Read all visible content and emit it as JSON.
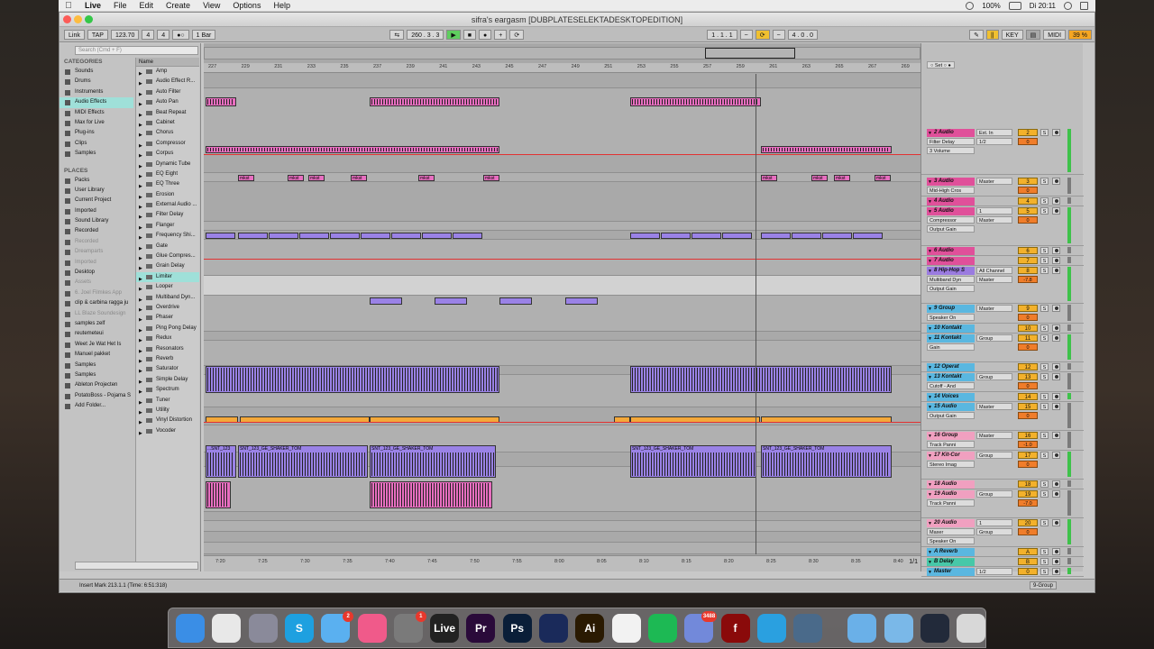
{
  "menubar": {
    "items": [
      "Live",
      "File",
      "Edit",
      "Create",
      "View",
      "Options",
      "Help"
    ],
    "battery": "100%",
    "clock": "Di 20:11",
    "icons": [
      "apple-icon",
      "wifi-icon",
      "battery-icon",
      "search-icon",
      "notification-icon"
    ]
  },
  "window": {
    "title": "sifra's eargasm  [DUBPLATESELEKTADESKTOPEDITION]"
  },
  "controlbar": {
    "link": "Link",
    "tap": "TAP",
    "tempo": "123.70",
    "signature_num": "4",
    "signature_den": "4",
    "quantize": "1 Bar",
    "position": "260 .   3 .   3",
    "loop_start": "1 .   1 .   1",
    "loop_length": "4 .   0 .   0",
    "key": "KEY",
    "midi": "MIDI",
    "cpu": "39 %"
  },
  "browser": {
    "search_placeholder": "Search (Cmd + F)",
    "categories_header": "CATEGORIES",
    "categories": [
      {
        "label": "Sounds",
        "selected": false
      },
      {
        "label": "Drums",
        "selected": false
      },
      {
        "label": "Instruments",
        "selected": false
      },
      {
        "label": "Audio Effects",
        "selected": true
      },
      {
        "label": "MIDI Effects",
        "selected": false
      },
      {
        "label": "Max for Live",
        "selected": false
      },
      {
        "label": "Plug-ins",
        "selected": false
      },
      {
        "label": "Clips",
        "selected": false
      },
      {
        "label": "Samples",
        "selected": false
      }
    ],
    "places_header": "PLACES",
    "places": [
      {
        "label": "Packs",
        "dim": false
      },
      {
        "label": "User Library",
        "dim": false
      },
      {
        "label": "Current Project",
        "dim": false
      },
      {
        "label": "Imported",
        "dim": false
      },
      {
        "label": "Sound Library",
        "dim": false
      },
      {
        "label": "Recorded",
        "dim": false
      },
      {
        "label": "Recorded",
        "dim": true
      },
      {
        "label": "Dreamparts",
        "dim": true
      },
      {
        "label": "Imported",
        "dim": true
      },
      {
        "label": "Desktop",
        "dim": false
      },
      {
        "label": "Assets",
        "dim": true
      },
      {
        "label": "6. Joel Filmkes App",
        "dim": true
      },
      {
        "label": "clip & carbina ragga ju",
        "dim": false
      },
      {
        "label": "LL Blaze Soundesign",
        "dim": true
      },
      {
        "label": "samples zelf",
        "dim": false
      },
      {
        "label": "reutemeteui",
        "dim": false
      },
      {
        "label": "Weet Je Wat Het Is",
        "dim": false
      },
      {
        "label": "Manuel pakket",
        "dim": false
      },
      {
        "label": "Samples",
        "dim": false
      },
      {
        "label": "Samples",
        "dim": false
      },
      {
        "label": "Ableton Projecten",
        "dim": false
      },
      {
        "label": "PotatoBoss - Pojama S",
        "dim": false
      },
      {
        "label": "Add Folder...",
        "dim": false
      }
    ],
    "names_header": "Name",
    "names": [
      {
        "label": "Amp",
        "selected": false
      },
      {
        "label": "Audio Effect R...",
        "selected": false
      },
      {
        "label": "Auto Filter",
        "selected": false
      },
      {
        "label": "Auto Pan",
        "selected": false
      },
      {
        "label": "Beat Repeat",
        "selected": false
      },
      {
        "label": "Cabinet",
        "selected": false
      },
      {
        "label": "Chorus",
        "selected": false
      },
      {
        "label": "Compressor",
        "selected": false
      },
      {
        "label": "Corpus",
        "selected": false
      },
      {
        "label": "Dynamic Tube",
        "selected": false
      },
      {
        "label": "EQ Eight",
        "selected": false
      },
      {
        "label": "EQ Three",
        "selected": false
      },
      {
        "label": "Erosion",
        "selected": false
      },
      {
        "label": "External Audio ...",
        "selected": false
      },
      {
        "label": "Filter Delay",
        "selected": false
      },
      {
        "label": "Flanger",
        "selected": false
      },
      {
        "label": "Frequency Shi...",
        "selected": false
      },
      {
        "label": "Gate",
        "selected": false
      },
      {
        "label": "Glue Compres...",
        "selected": false
      },
      {
        "label": "Grain Delay",
        "selected": false
      },
      {
        "label": "Limiter",
        "selected": true
      },
      {
        "label": "Looper",
        "selected": false
      },
      {
        "label": "Multiband Dyn...",
        "selected": false
      },
      {
        "label": "Overdrive",
        "selected": false
      },
      {
        "label": "Phaser",
        "selected": false
      },
      {
        "label": "Ping Pong Delay",
        "selected": false
      },
      {
        "label": "Redux",
        "selected": false
      },
      {
        "label": "Resonators",
        "selected": false
      },
      {
        "label": "Reverb",
        "selected": false
      },
      {
        "label": "Saturator",
        "selected": false
      },
      {
        "label": "Simple Delay",
        "selected": false
      },
      {
        "label": "Spectrum",
        "selected": false
      },
      {
        "label": "Tuner",
        "selected": false
      },
      {
        "label": "Utility",
        "selected": false
      },
      {
        "label": "Vinyl Distortion",
        "selected": false
      },
      {
        "label": "Vocoder",
        "selected": false
      }
    ]
  },
  "arrangement": {
    "beat_ticks": [
      "227",
      "229",
      "231",
      "233",
      "235",
      "237",
      "239",
      "241",
      "243",
      "245",
      "247",
      "249",
      "251",
      "253",
      "255",
      "257",
      "259",
      "261",
      "263",
      "265",
      "267",
      "269"
    ],
    "time_ticks": [
      "7:20",
      "7:25",
      "7:30",
      "7:35",
      "7:40",
      "7:45",
      "7:50",
      "7:55",
      "8:00",
      "8:05",
      "8:10",
      "8:15",
      "8:20",
      "8:25",
      "8:30",
      "8:35",
      "8:40"
    ],
    "clip_label_shaker": "SNT_123_GE_SHAKER_TOM",
    "clip_label_short": "...SNT_123",
    "clip_label_mk": "mkst",
    "page_indicator": "1/1"
  },
  "mixer": {
    "set_button": "Set",
    "tracks": [
      {
        "name": "2 Audio",
        "color": "#e0509a",
        "device": "Filter Delay",
        "device2": "3 Volume",
        "route": "Ext. In",
        "route2": "1/2",
        "num": "2",
        "vol": "0"
      },
      {
        "name": "3 Audio",
        "color": "#e0509a",
        "device": "Mid-High Cros",
        "route": "Master",
        "num": "3",
        "vol": "0"
      },
      {
        "name": "4 Audio",
        "color": "#e0509a",
        "device": "",
        "route": "",
        "num": "4",
        "vol": "0"
      },
      {
        "name": "5 Audio",
        "color": "#e0509a",
        "device": "Compressor",
        "device2": "Output Gain",
        "route": "1",
        "route2": "Master",
        "num": "5",
        "vol": "0"
      },
      {
        "name": "6 Audio",
        "color": "#e0509a",
        "device": "",
        "route": "",
        "num": "6",
        "vol": "0"
      },
      {
        "name": "7 Audio",
        "color": "#e0509a",
        "device": "",
        "route": "",
        "num": "7",
        "vol": "0"
      },
      {
        "name": "8 Hip-Hop S",
        "color": "#9a7be0",
        "device": "Multiband Dyn",
        "device2": "Output Gain",
        "route": "All Channel",
        "route2": "Master",
        "num": "8",
        "vol": "-7.8"
      },
      {
        "name": "9 Group",
        "color": "#5ab7e0",
        "device": "Speaker On",
        "route": "Master",
        "num": "9",
        "vol": "0"
      },
      {
        "name": "10 Kontakt",
        "color": "#5ab7e0",
        "device": "",
        "route": "",
        "num": "10",
        "vol": "0"
      },
      {
        "name": "11 Kontakt",
        "color": "#5ab7e0",
        "device": "Gain",
        "route": "Group",
        "num": "11",
        "vol": "0"
      },
      {
        "name": "12 Operat",
        "color": "#5ab7e0",
        "device": "",
        "route": "",
        "num": "12",
        "vol": "0"
      },
      {
        "name": "13 Kontakt",
        "color": "#5ab7e0",
        "device": "Cutoff - And",
        "route": "Group",
        "num": "13",
        "vol": "0"
      },
      {
        "name": "14 Voices",
        "color": "#5ab7e0",
        "device": "",
        "route": "",
        "num": "14",
        "vol": "0"
      },
      {
        "name": "15 Audio",
        "color": "#5ab7e0",
        "device": "Output Gain",
        "route": "Master",
        "num": "15",
        "vol": "0"
      },
      {
        "name": "16 Group",
        "color": "#f0a0c0",
        "device": "Track Panni",
        "route": "Master",
        "num": "16",
        "vol": "-1.0"
      },
      {
        "name": "17 Kit-Cor",
        "color": "#f0a0c0",
        "device": "Stereo Imag",
        "route": "Group",
        "num": "17",
        "vol": "0"
      },
      {
        "name": "18 Audio",
        "color": "#f0a0c0",
        "device": "",
        "route": "",
        "num": "18",
        "vol": "0"
      },
      {
        "name": "19 Audio",
        "color": "#f0a0c0",
        "device": "Track Panni",
        "route": "Group",
        "num": "19",
        "vol": "-7.0"
      },
      {
        "name": "20 Audio",
        "color": "#f0a0c0",
        "device": "Maxer",
        "device2": "Speaker On",
        "route": "1",
        "route2": "Group",
        "num": "20",
        "vol": "0"
      },
      {
        "name": "A Reverb",
        "color": "#5ab7e0",
        "device": "",
        "route": "",
        "num": "A",
        "vol": "0"
      },
      {
        "name": "B Delay",
        "color": "#47c8a8",
        "device": "",
        "route": "",
        "num": "B",
        "vol": "0"
      },
      {
        "name": "Master",
        "color": "#5ab7e0",
        "device": "",
        "route": "1/2",
        "num": "0",
        "vol": "0"
      }
    ]
  },
  "statusbar": {
    "text": "Insert Mark 213.1.1 (Time: 6:51:318)",
    "group": "9-Group"
  },
  "dock": {
    "apps": [
      {
        "name": "Finder",
        "label": "",
        "color": "#3a8ee6",
        "badge": ""
      },
      {
        "name": "Chrome",
        "label": "",
        "color": "#e8e8e8",
        "badge": ""
      },
      {
        "name": "Launchpad",
        "label": "",
        "color": "#8a8a9a",
        "badge": ""
      },
      {
        "name": "Skype",
        "label": "S",
        "color": "#1ea0e0",
        "badge": ""
      },
      {
        "name": "Messages",
        "label": "",
        "color": "#5ab0f0",
        "badge": "2"
      },
      {
        "name": "iTunes",
        "label": "",
        "color": "#f05a8a",
        "badge": ""
      },
      {
        "name": "System Preferences",
        "label": "",
        "color": "#7a7a7a",
        "badge": "1"
      },
      {
        "name": "Live",
        "label": "Live",
        "color": "#222222",
        "badge": ""
      },
      {
        "name": "Premiere",
        "label": "Pr",
        "color": "#2a0a3a",
        "badge": ""
      },
      {
        "name": "Photoshop",
        "label": "Ps",
        "color": "#0a1e38",
        "badge": ""
      },
      {
        "name": "Night Owl",
        "label": "",
        "color": "#1a2a5a",
        "badge": ""
      },
      {
        "name": "Illustrator",
        "label": "Ai",
        "color": "#2a1a02",
        "badge": ""
      },
      {
        "name": "Photos",
        "label": "",
        "color": "#f2f2f2",
        "badge": ""
      },
      {
        "name": "Spotify",
        "label": "",
        "color": "#1db954",
        "badge": ""
      },
      {
        "name": "Discord",
        "label": "",
        "color": "#7289da",
        "badge": "3488"
      },
      {
        "name": "Flash",
        "label": "f",
        "color": "#8a0a0a",
        "badge": ""
      },
      {
        "name": "Telegram",
        "label": "",
        "color": "#2aa0e0",
        "badge": ""
      },
      {
        "name": "QuickTime",
        "label": "",
        "color": "#4a6a8a",
        "badge": ""
      },
      {
        "name": "Applications",
        "label": "",
        "color": "#6ab0e8",
        "badge": ""
      },
      {
        "name": "Downloads",
        "label": "",
        "color": "#7ab8e8",
        "badge": ""
      },
      {
        "name": "Desktop Folder",
        "label": "",
        "color": "#222a3a",
        "badge": ""
      },
      {
        "name": "Trash",
        "label": "",
        "color": "#d8d8d8",
        "badge": ""
      }
    ]
  }
}
